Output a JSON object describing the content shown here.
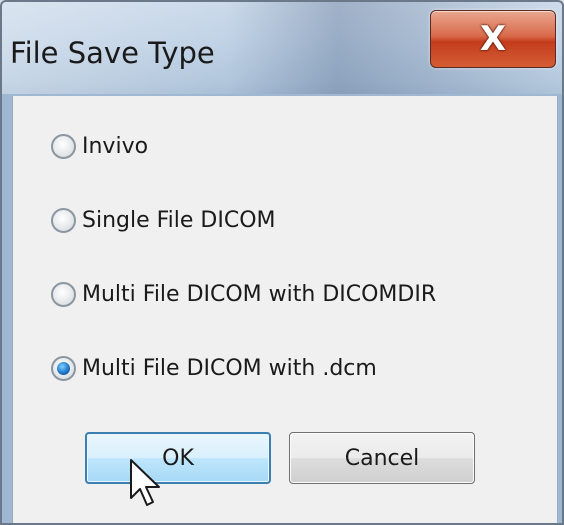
{
  "window": {
    "title": "File Save Type",
    "close_glyph": "X"
  },
  "options": [
    {
      "label": "Invivo",
      "selected": false
    },
    {
      "label": "Single File DICOM",
      "selected": false
    },
    {
      "label": "Multi File DICOM with DICOMDIR",
      "selected": false
    },
    {
      "label": "Multi File DICOM with .dcm",
      "selected": true
    }
  ],
  "buttons": {
    "ok_label": "OK",
    "cancel_label": "Cancel"
  },
  "icons": {
    "close": "close-icon",
    "cursor": "mouse-pointer-icon"
  },
  "colors": {
    "close_button": "#c43c1c",
    "radio_selected": "#1f78c8",
    "ok_border": "#3c7fb1"
  }
}
